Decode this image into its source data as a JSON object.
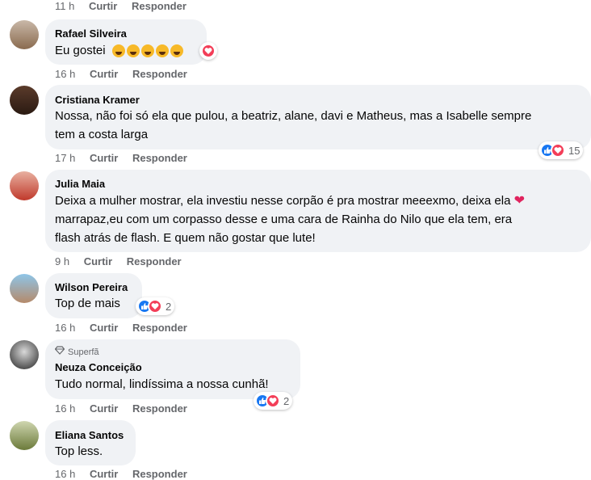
{
  "actions": {
    "like": "Curtir",
    "reply": "Responder"
  },
  "top_meta": {
    "time": "11 h"
  },
  "comments": [
    {
      "name": "Rafael Silveira",
      "text": "Eu gostei",
      "emojis": [
        "laughing-crying-icon",
        "laughing-crying-icon",
        "laughing-crying-icon",
        "laughing-crying-icon",
        "heart-face-icon"
      ],
      "time": "16 h",
      "reaction": {
        "icons": [
          "love"
        ],
        "count": ""
      }
    },
    {
      "name": "Cristiana Kramer",
      "lines": [
        "Nossa, não foi só ela que pulou, a beatriz, alane, davi e Matheus, mas a Isabelle sempre",
        "tem a costa larga"
      ],
      "time": "17 h",
      "reaction": {
        "icons": [
          "like",
          "love"
        ],
        "count": "15"
      }
    },
    {
      "name": "Julia Maia",
      "lines": [
        "Deixa a mulher mostrar, ela investiu nesse corpão é pra mostrar meeexmo, deixa ela",
        "marrapaz,eu com um corpasso desse e uma cara de Rainha do Nilo que ela tem, era",
        "flash atrás de flash. E quem não gostar que lute!"
      ],
      "time": "9 h"
    },
    {
      "name": "Wilson Pereira",
      "text": "Top de mais",
      "time": "16 h",
      "reaction": {
        "icons": [
          "like",
          "love"
        ],
        "count": "2"
      }
    },
    {
      "badge": "Superfã",
      "name": "Neuza Conceição",
      "text": "Tudo normal, lindíssima a nossa cunhã!",
      "time": "16 h",
      "reaction": {
        "icons": [
          "like",
          "love"
        ],
        "count": "2"
      }
    },
    {
      "name": "Eliana Santos",
      "text": "Top less.",
      "time": "16 h"
    }
  ],
  "colors": {
    "bubble": "#f0f2f5",
    "like": "#1877f2",
    "love": "#f33e58",
    "meta": "#65676b"
  }
}
